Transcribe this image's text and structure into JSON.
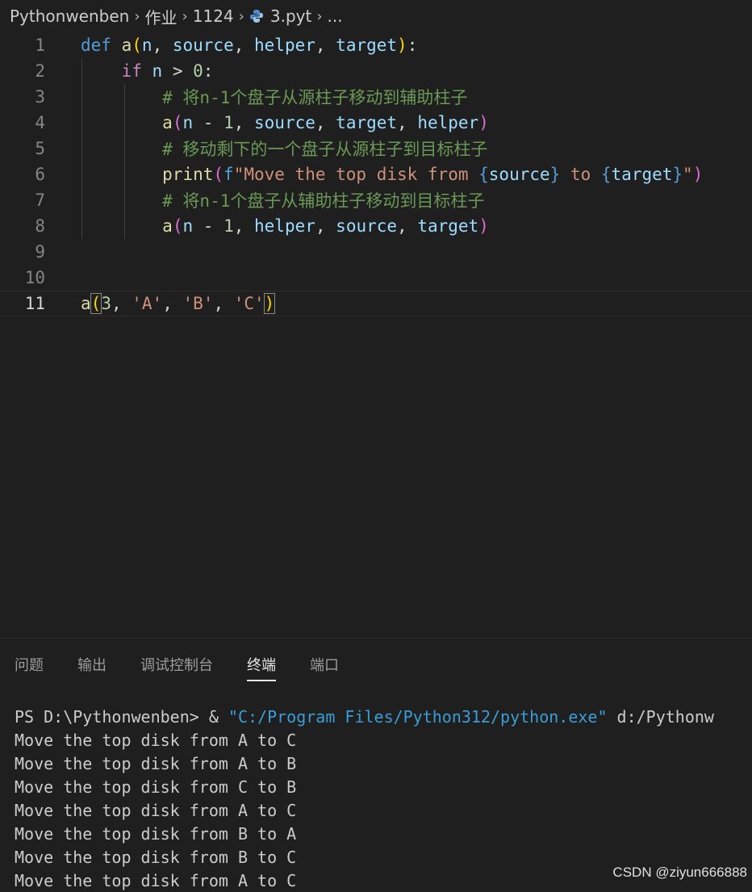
{
  "breadcrumb": {
    "items": [
      "Pythonwenben",
      "作业",
      "1124"
    ],
    "file": "3.pyt",
    "ellipsis": "...",
    "file_icon": "python-icon"
  },
  "editor": {
    "lines": [
      {
        "num": "1",
        "text": "def a(n, source, helper, target):"
      },
      {
        "num": "2",
        "text": "    if n > 0:"
      },
      {
        "num": "3",
        "text": "        # 将n-1个盘子从源柱子移动到辅助柱子"
      },
      {
        "num": "4",
        "text": "        a(n - 1, source, target, helper)"
      },
      {
        "num": "5",
        "text": "        # 移动剩下的一个盘子从源柱子到目标柱子"
      },
      {
        "num": "6",
        "text": "        print(f\"Move the top disk from {source} to {target}\")"
      },
      {
        "num": "7",
        "text": "        # 将n-1个盘子从辅助柱子移动到目标柱子"
      },
      {
        "num": "8",
        "text": "        a(n - 1, helper, source, target)"
      },
      {
        "num": "9",
        "text": ""
      },
      {
        "num": "10",
        "text": ""
      },
      {
        "num": "11",
        "text": "a(3, 'A', 'B', 'C')"
      }
    ],
    "current_line": "11"
  },
  "panel": {
    "tabs": [
      "问题",
      "输出",
      "调试控制台",
      "终端",
      "端口"
    ],
    "active_tab": "终端"
  },
  "terminal": {
    "prompt": "PS D:\\Pythonwenben> & ",
    "exe": "\"C:/Program Files/Python312/python.exe\"",
    "arg": " d:/Pythonw",
    "output": [
      "Move the top disk from A to C",
      "Move the top disk from A to B",
      "Move the top disk from C to B",
      "Move the top disk from A to C",
      "Move the top disk from B to A",
      "Move the top disk from B to C",
      "Move the top disk from A to C"
    ]
  },
  "watermark": "CSDN @ziyun666888",
  "colors": {
    "background": "#1f1f1f",
    "keyword": "#569cd6",
    "function": "#dcdcaa",
    "variable": "#9cdcfe",
    "comment": "#6a9955",
    "string": "#ce9178"
  }
}
